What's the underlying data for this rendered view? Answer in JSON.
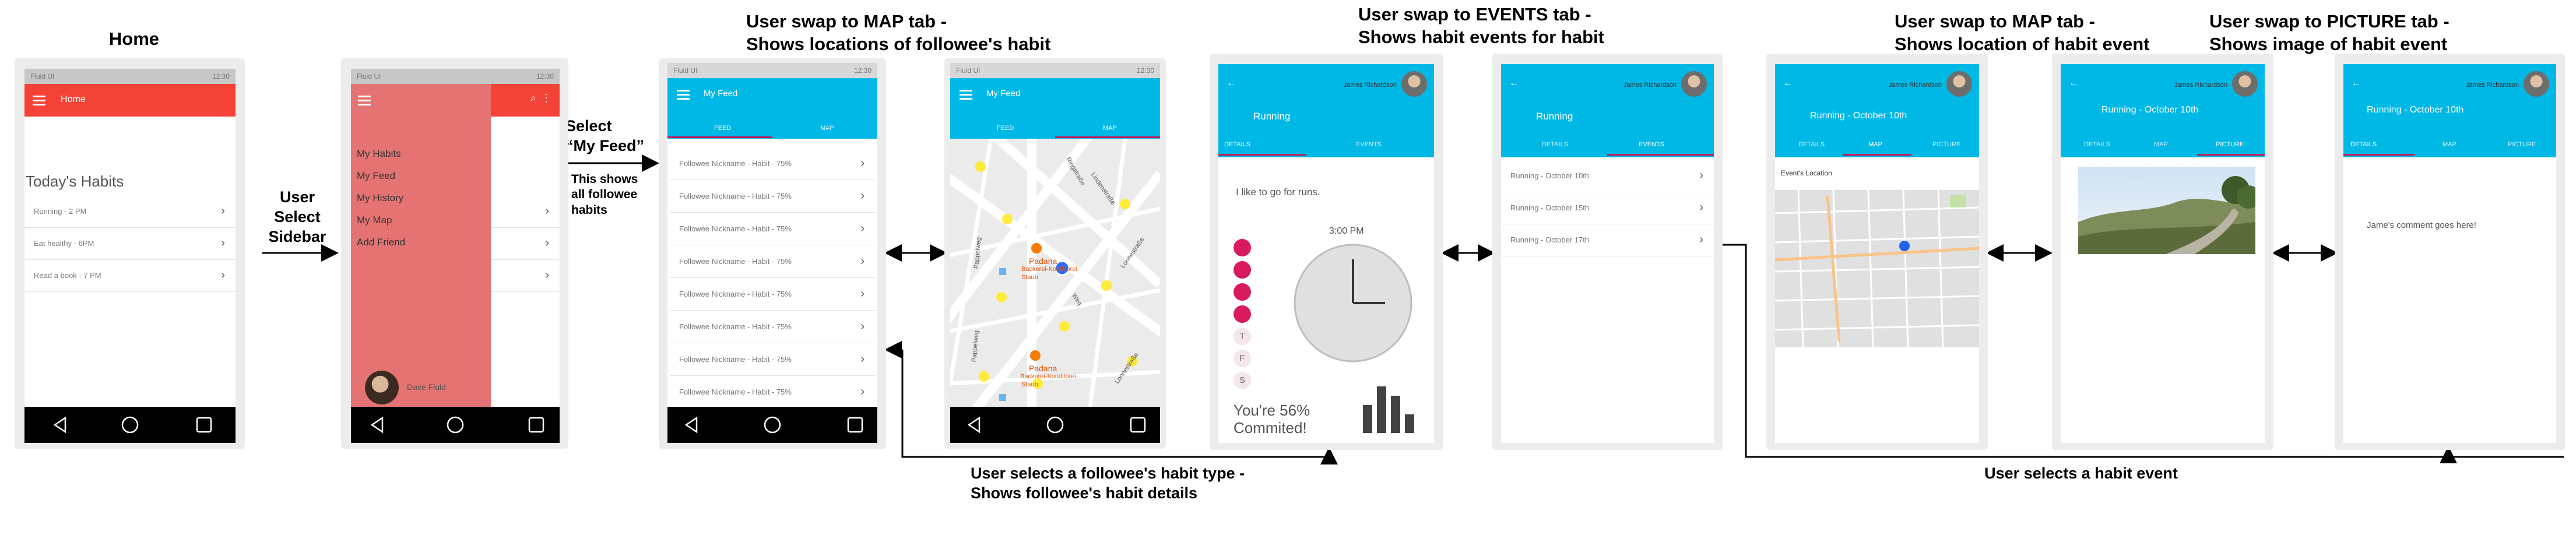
{
  "titles": {
    "home": "Home",
    "map_feed": "User swap to MAP tab -\nShows locations of followee's habit",
    "events": "User swap to EVENTS tab -\nShows habit events for habit",
    "map_event": "User swap to MAP tab -\nShows location of habit event",
    "picture": "User swap to PICTURE tab -\nShows image of habit event"
  },
  "notes": {
    "select_sidebar": "User\nSelect\nSidebar",
    "select_feed": "Select\n“My Feed”",
    "feed_desc": "This shows\nall followee\nhabits",
    "followee_type": "User selects a followee's habit type -\nShows followee's habit details",
    "habit_event": "User selects a habit event"
  },
  "status": {
    "left": "Fluid UI",
    "time": "12:30"
  },
  "home": {
    "app_title": "Home",
    "section": "Today's Habits",
    "items": [
      "Running - 2 PM",
      "Eat healthy - 6PM",
      "Read a book - 7 PM"
    ]
  },
  "sidebar": {
    "items": [
      "My Habits",
      "My Feed",
      "My History",
      "My Map",
      "Add Friend"
    ],
    "user": "Dave Fluid"
  },
  "feed": {
    "title": "My Feed",
    "tabs": [
      "FEED",
      "MAP"
    ],
    "row": "Followee Nickname - Habit - 75%",
    "row_count": 8
  },
  "map_labels": [
    "Padana",
    "Backerei-Konditorei",
    "Staub",
    "Lindenstraße",
    "Weg",
    "Ringstraße",
    "Pappelweg",
    "Lonnestraße"
  ],
  "profile": {
    "name": "James Richardson"
  },
  "details": {
    "habit": "Running",
    "tabs": [
      "DETAILS",
      "EVENTS"
    ],
    "description": "I like to go for runs.",
    "time": "3:00 PM",
    "days": [
      "",
      "",
      "",
      "",
      "T",
      "F",
      "S"
    ],
    "commit": "You're 56%\nCommited!"
  },
  "events": {
    "habit": "Running",
    "tabs": [
      "DETAILS",
      "EVENTS"
    ],
    "items": [
      "Running - October 10th",
      "Running - October 15th",
      "Running - October 17th"
    ]
  },
  "event": {
    "title": "Running - October 10th",
    "tabs": [
      "DETAILS",
      "MAP",
      "PICTURE"
    ],
    "location_label": "Event's Location",
    "comment": "Jame's comment goes here!"
  },
  "colors": {
    "red": "#f44336",
    "sidebar": "#e57373",
    "cyan": "#00b8e6",
    "pink": "#d81b60",
    "magenta": "#c2185b"
  }
}
